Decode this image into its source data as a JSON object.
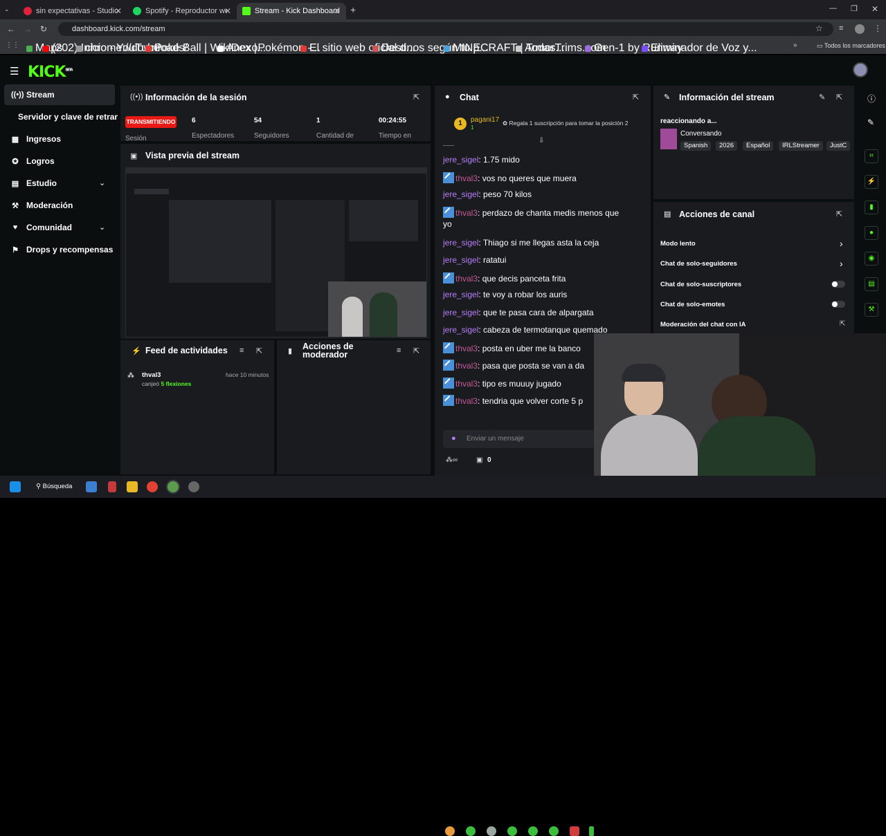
{
  "browser": {
    "tabs": [
      {
        "title": "sin expectativas - Studio",
        "color": "#e0223b"
      },
      {
        "title": "Spotify - Reproductor web: mú",
        "color": "#1ed760"
      },
      {
        "title": "Stream - Kick Dashboard",
        "color": "#53fc18"
      }
    ],
    "url": "dashboard.kick.com/stream",
    "bookmarks": [
      {
        "label": "Maps",
        "color": "#4caf50"
      },
      {
        "label": "(202) Inicio - YouTube",
        "color": "#ff0000"
      },
      {
        "label": "chrome://downloads/",
        "color": "#999999"
      },
      {
        "label": "Poké Ball | WikiDex |...",
        "color": "#e53935"
      },
      {
        "label": "AnexoPokémon -...",
        "color": "#ffffff"
      },
      {
        "label": "El sitio web oficial d...",
        "color": "#e53935"
      },
      {
        "label": "Destinos según tu p...",
        "color": "#cc5555"
      },
      {
        "label": "MINECRAFT | Todas...",
        "color": "#4aa3df"
      },
      {
        "label": "ArmorTrims.com",
        "color": "#cccccc"
      },
      {
        "label": "Gen-1 by Runway",
        "color": "#9c6dd8"
      },
      {
        "label": "Eliminador de Voz y...",
        "color": "#7c4dff"
      }
    ],
    "bookmarks_all": "Todos los marcadores"
  },
  "brand": {
    "logo": "KICK",
    "beta": "BETA",
    "accent": "#53fc18"
  },
  "sidebar": {
    "items": [
      {
        "label": "Stream",
        "icon": "stream-icon"
      },
      {
        "label": "Servidor y clave de retransmisión",
        "icon": ""
      },
      {
        "label": "Ingresos",
        "icon": "revenue-icon"
      },
      {
        "label": "Logros",
        "icon": "achievements-icon"
      },
      {
        "label": "Estudio",
        "icon": "studio-icon"
      },
      {
        "label": "Moderación",
        "icon": "moderation-icon"
      },
      {
        "label": "Comunidad",
        "icon": "community-icon"
      },
      {
        "label": "Drops y recompensas",
        "icon": "drops-icon"
      }
    ]
  },
  "session": {
    "title": "Información de la sesión",
    "status": "TRANSMITIENDO",
    "status_sub": "Sesión",
    "stats": [
      {
        "value": "6",
        "label": "Espectadores"
      },
      {
        "value": "54",
        "label": "Seguidores"
      },
      {
        "value": "1",
        "label": "Cantidad de"
      },
      {
        "value": "00:24:55",
        "label": "Tiempo en"
      }
    ]
  },
  "preview": {
    "title": "Vista previa del stream"
  },
  "feed": {
    "title": "Feed de actividades",
    "items": [
      {
        "user": "thval3",
        "action": "canjeó",
        "reward": "5 flexiones",
        "time": "hace 10 minutos"
      }
    ]
  },
  "mod_actions": {
    "title": "Acciones de moderador"
  },
  "chat": {
    "title": "Chat",
    "pinned": {
      "rank": "1",
      "user": "pagani17",
      "count": "1",
      "promo": "Regala 1 suscripción para tomar la posición 2"
    },
    "messages": [
      {
        "user": "jere_sigel",
        "mod": false,
        "text": ": 1.75 mido"
      },
      {
        "user": "thval3",
        "mod": true,
        "text": ": vos no queres que muera"
      },
      {
        "user": "jere_sigel",
        "mod": false,
        "text": ": peso 70 kilos"
      },
      {
        "user": "thval3",
        "mod": true,
        "text": ": perdazo de chanta medis menos que"
      },
      {
        "user": "",
        "mod": false,
        "text": "yo"
      },
      {
        "user": "jere_sigel",
        "mod": false,
        "text": ": Thiago si me llegas asta la ceja"
      },
      {
        "user": "jere_sigel",
        "mod": false,
        "text": ": ratatui"
      },
      {
        "user": "thval3",
        "mod": true,
        "text": ": que decis panceta frita"
      },
      {
        "user": "jere_sigel",
        "mod": false,
        "text": ": te voy a robar los auris"
      },
      {
        "user": "jere_sigel",
        "mod": false,
        "text": ": que te pasa cara de alpargata"
      },
      {
        "user": "jere_sigel",
        "mod": false,
        "text": ": cabeza de termotanque quemado"
      },
      {
        "user": "thval3",
        "mod": true,
        "text": ": posta en uber me la banco"
      },
      {
        "user": "thval3",
        "mod": true,
        "text": ": pasa que posta se van a da"
      },
      {
        "user": "thval3",
        "mod": true,
        "text": ": tipo es muuuy jugado"
      },
      {
        "user": "thval3",
        "mod": true,
        "text": ": tendria que volver corte 5 p"
      }
    ],
    "input_placeholder": "Enviar un mensaje",
    "points": "0"
  },
  "stream_info": {
    "title": "Información del stream",
    "reacting": "reaccionando a...",
    "category": "Conversando",
    "tags": [
      "Spanish",
      "2026",
      "Español",
      "IRLStreamer",
      "JustC"
    ]
  },
  "channel_actions": {
    "title": "Acciones de canal",
    "items": [
      {
        "label": "Modo lento",
        "control": "chevron"
      },
      {
        "label": "Chat de solo-seguidores",
        "control": "chevron"
      },
      {
        "label": "Chat de solo-suscriptores",
        "control": "toggle"
      },
      {
        "label": "Chat de solo-emotes",
        "control": "toggle"
      },
      {
        "label": "Moderación del chat con IA",
        "control": "link"
      }
    ]
  },
  "taskbar": {
    "search": "Búsqueda"
  }
}
